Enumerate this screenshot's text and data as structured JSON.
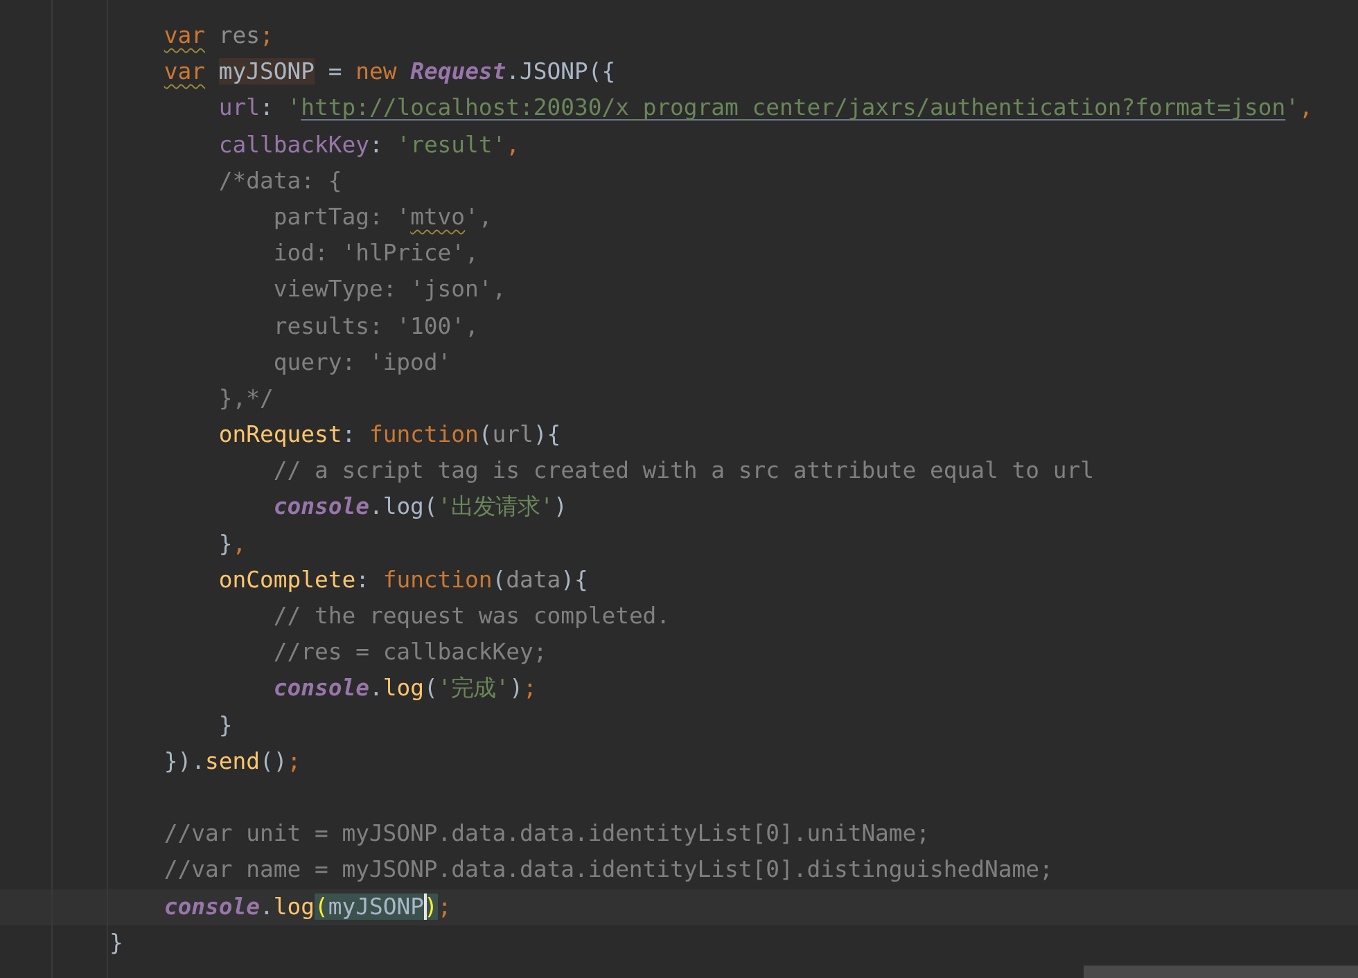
{
  "editor": {
    "lines": [
      {
        "kind": "code",
        "tokens": [
          {
            "kind": "keyword-warn",
            "text": "            var "
          },
          {
            "kind": "unused",
            "text": "res"
          },
          {
            "kind": "punct",
            "text": ";"
          }
        ]
      },
      {
        "kind": "code",
        "tokens": [
          {
            "kind": "keyword-warn",
            "text": "            var "
          },
          {
            "kind": "ident-highlight",
            "text": "myJSONP"
          },
          {
            "kind": "text",
            "text": " = "
          },
          {
            "kind": "keyword",
            "text": "new "
          },
          {
            "kind": "global",
            "text": "Request"
          },
          {
            "kind": "text",
            "text": ".JSONP({"
          }
        ]
      },
      {
        "kind": "code",
        "tokens": [
          {
            "kind": "property",
            "text": "                url"
          },
          {
            "kind": "text",
            "text": ": "
          },
          {
            "kind": "string",
            "text": "'"
          },
          {
            "kind": "url",
            "text": "http://localhost:20030/x_program_center/jaxrs/authentication?format=json"
          },
          {
            "kind": "string",
            "text": "'"
          },
          {
            "kind": "punct",
            "text": ","
          }
        ]
      },
      {
        "kind": "code",
        "tokens": [
          {
            "kind": "property",
            "text": "                callbackKey"
          },
          {
            "kind": "text",
            "text": ": "
          },
          {
            "kind": "string",
            "text": "'result'"
          },
          {
            "kind": "punct",
            "text": ","
          }
        ]
      },
      {
        "kind": "code",
        "tokens": [
          {
            "kind": "comment",
            "text": "                /*data: {"
          }
        ]
      },
      {
        "kind": "code",
        "tokens": [
          {
            "kind": "comment",
            "text": "                    partTag: '"
          },
          {
            "kind": "comment-warn",
            "text": "mtvo"
          },
          {
            "kind": "comment",
            "text": "',"
          }
        ]
      },
      {
        "kind": "code",
        "tokens": [
          {
            "kind": "comment",
            "text": "                    iod: 'hlPrice',"
          }
        ]
      },
      {
        "kind": "code",
        "tokens": [
          {
            "kind": "comment",
            "text": "                    viewType: 'json',"
          }
        ]
      },
      {
        "kind": "code",
        "tokens": [
          {
            "kind": "comment",
            "text": "                    results: '100',"
          }
        ]
      },
      {
        "kind": "code",
        "tokens": [
          {
            "kind": "comment",
            "text": "                    query: 'ipod'"
          }
        ]
      },
      {
        "kind": "code",
        "tokens": [
          {
            "kind": "comment",
            "text": "                },*/"
          }
        ]
      },
      {
        "kind": "code",
        "tokens": [
          {
            "kind": "function",
            "text": "                onRequest"
          },
          {
            "kind": "text",
            "text": ": "
          },
          {
            "kind": "keyword",
            "text": "function"
          },
          {
            "kind": "text",
            "text": "("
          },
          {
            "kind": "unused",
            "text": "url"
          },
          {
            "kind": "text",
            "text": "){"
          }
        ]
      },
      {
        "kind": "code",
        "tokens": [
          {
            "kind": "comment",
            "text": "                    // a script tag is created with a src attribute equal to url"
          }
        ]
      },
      {
        "kind": "code",
        "tokens": [
          {
            "kind": "global",
            "text": "                    console"
          },
          {
            "kind": "text",
            "text": ".log("
          },
          {
            "kind": "string",
            "text": "'出发请求'"
          },
          {
            "kind": "text",
            "text": ")"
          }
        ]
      },
      {
        "kind": "code",
        "tokens": [
          {
            "kind": "text",
            "text": "                }"
          },
          {
            "kind": "punct",
            "text": ","
          }
        ]
      },
      {
        "kind": "code",
        "tokens": [
          {
            "kind": "function",
            "text": "                onComplete"
          },
          {
            "kind": "text",
            "text": ": "
          },
          {
            "kind": "keyword",
            "text": "function"
          },
          {
            "kind": "text",
            "text": "("
          },
          {
            "kind": "unused",
            "text": "data"
          },
          {
            "kind": "text",
            "text": "){"
          }
        ]
      },
      {
        "kind": "code",
        "tokens": [
          {
            "kind": "comment",
            "text": "                    // the request was completed."
          }
        ]
      },
      {
        "kind": "code",
        "tokens": [
          {
            "kind": "comment",
            "text": "                    //res = callbackKey;"
          }
        ]
      },
      {
        "kind": "code",
        "tokens": [
          {
            "kind": "global",
            "text": "                    console"
          },
          {
            "kind": "text",
            "text": "."
          },
          {
            "kind": "function",
            "text": "log"
          },
          {
            "kind": "text",
            "text": "("
          },
          {
            "kind": "string",
            "text": "'完成'"
          },
          {
            "kind": "text",
            "text": ")"
          },
          {
            "kind": "punct",
            "text": ";"
          }
        ]
      },
      {
        "kind": "code",
        "tokens": [
          {
            "kind": "text",
            "text": "                }"
          }
        ]
      },
      {
        "kind": "code",
        "tokens": [
          {
            "kind": "text",
            "text": "            })."
          },
          {
            "kind": "function",
            "text": "send"
          },
          {
            "kind": "text",
            "text": "()"
          },
          {
            "kind": "punct",
            "text": ";"
          }
        ]
      },
      {
        "kind": "blank"
      },
      {
        "kind": "code",
        "tokens": [
          {
            "kind": "comment",
            "text": "            //var unit = myJSONP.data.data.identityList[0].unitName;"
          }
        ]
      },
      {
        "kind": "code",
        "tokens": [
          {
            "kind": "comment",
            "text": "            //var name = myJSONP.data.data.identityList[0].distinguishedName;"
          }
        ]
      },
      {
        "kind": "current",
        "tokens": [
          {
            "kind": "global",
            "text": "            console"
          },
          {
            "kind": "text",
            "text": "."
          },
          {
            "kind": "function",
            "text": "log"
          },
          {
            "kind": "match-brace",
            "text": "("
          },
          {
            "kind": "match-text",
            "text": "myJSONP"
          },
          {
            "kind": "match-brace-caret",
            "text": ")"
          },
          {
            "kind": "punct",
            "text": ";"
          }
        ]
      },
      {
        "kind": "code",
        "tokens": [
          {
            "kind": "text",
            "text": "        }"
          }
        ]
      }
    ]
  }
}
